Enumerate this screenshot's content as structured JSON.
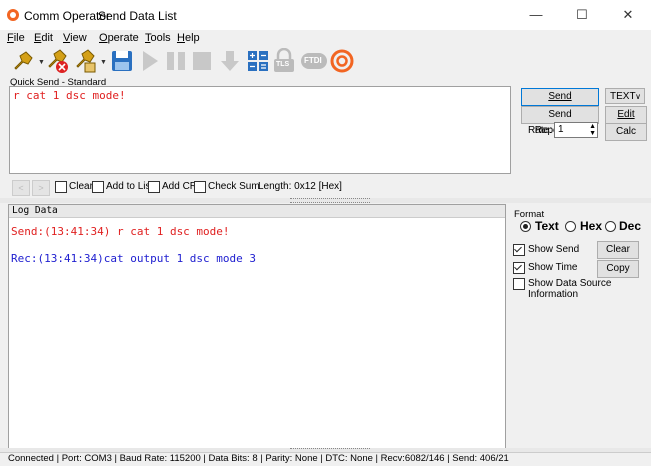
{
  "window": {
    "app_title": "Comm Operator",
    "doc_title": "Send Data List",
    "minimize": "—",
    "maximize": "☐",
    "close": "✕"
  },
  "menu": [
    "File",
    "Edit",
    "View",
    "Operate",
    "Tools",
    "Help"
  ],
  "menu_underline": [
    "F",
    "E",
    "V",
    "O",
    "T",
    "H"
  ],
  "toolbar": {
    "icons": [
      "connect-icon",
      "disconnect-icon",
      "plug-settings-icon",
      "save-icon",
      "play-icon",
      "pause-icon",
      "stop-icon",
      "download-icon",
      "calculator-icon",
      "tls-icon",
      "ftdi-icon",
      "comm-operator-logo-icon"
    ],
    "tls_label": "TLS",
    "ftdi_label": "FTDI"
  },
  "quick_send": {
    "label": "Quick Send - Standard",
    "text": "r cat 1 dsc mode!",
    "send_label": "Send",
    "send_repeatedly_label": "Send Repeatedly",
    "format_value": "TEXT",
    "edit_label": "Edit",
    "rate_label": "Rate:",
    "rate_value": "1",
    "calc_label": "Calc",
    "prev_arrow": "<",
    "next_arrow": ">",
    "options": [
      {
        "label": "Clear",
        "checked": false
      },
      {
        "label": "Add to List",
        "checked": false
      },
      {
        "label": "Add CR",
        "checked": false
      },
      {
        "label": "Check Sum",
        "checked": false
      }
    ],
    "length_text": "Length: 0x12 [Hex]"
  },
  "log": {
    "title": "Log Data",
    "lines": [
      {
        "text": "Send:(13:41:34) r cat 1 dsc mode!",
        "color": "#e02020"
      },
      {
        "text": "Rec:(13:41:34)cat output 1 dsc mode 3",
        "color": "#2020d0"
      }
    ]
  },
  "format_panel": {
    "label": "Format",
    "options": [
      {
        "label": "Text",
        "selected": true
      },
      {
        "label": "Hex",
        "selected": false
      },
      {
        "label": "Dec",
        "selected": false
      }
    ],
    "show_send_label": "Show Send",
    "show_send_checked": true,
    "show_time_label": "Show Time",
    "show_time_checked": true,
    "show_source_label": "Show Data Source Information",
    "show_source_checked": false,
    "clear_label": "Clear",
    "copy_label": "Copy"
  },
  "status": "Connected | Port: COM3 | Baud Rate: 115200 | Data Bits: 8 | Parity: None | DTC: None | Recv:6082/146 | Send: 406/21"
}
